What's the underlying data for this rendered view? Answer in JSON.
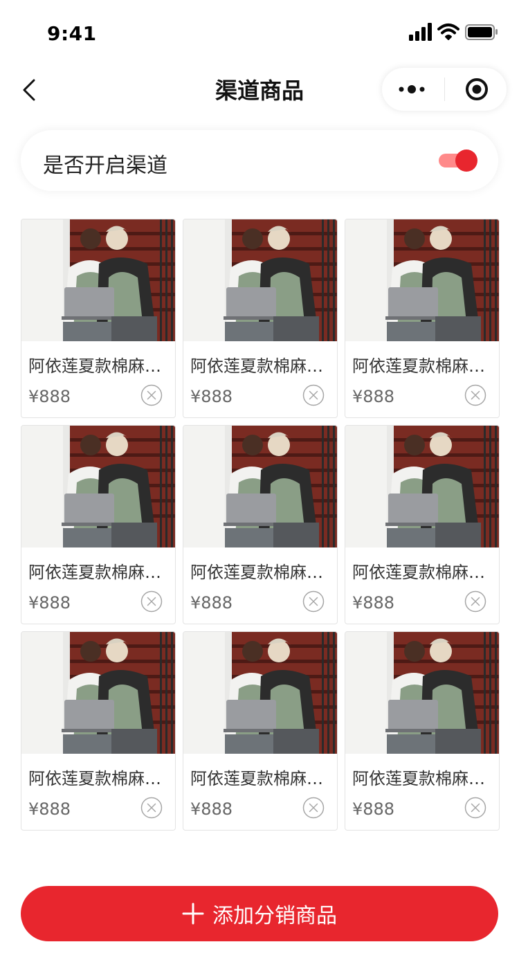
{
  "status_bar": {
    "time": "9:41",
    "icons": [
      "signal-icon",
      "wifi-icon",
      "battery-icon"
    ]
  },
  "nav": {
    "title": "渠道商品",
    "back_icon": "chevron-left-icon",
    "more_icon": "more-dots-icon",
    "close_icon": "target-icon"
  },
  "channel_toggle": {
    "label": "是否开启渠道",
    "enabled": true
  },
  "products": [
    {
      "name": "阿依莲夏款棉麻…",
      "price": "¥888"
    },
    {
      "name": "阿依莲夏款棉麻…",
      "price": "¥888"
    },
    {
      "name": "阿依莲夏款棉麻…",
      "price": "¥888"
    },
    {
      "name": "阿依莲夏款棉麻…",
      "price": "¥888"
    },
    {
      "name": "阿依莲夏款棉麻…",
      "price": "¥888"
    },
    {
      "name": "阿依莲夏款棉麻…",
      "price": "¥888"
    },
    {
      "name": "阿依莲夏款棉麻…",
      "price": "¥888"
    },
    {
      "name": "阿依莲夏款棉麻…",
      "price": "¥888"
    },
    {
      "name": "阿依莲夏款棉麻…",
      "price": "¥888"
    }
  ],
  "add_button": {
    "label": "添加分销商品",
    "icon": "plus-icon"
  },
  "colors": {
    "accent": "#e8262e",
    "switch_track": "#ff8a8a",
    "background": "#ffffff"
  }
}
